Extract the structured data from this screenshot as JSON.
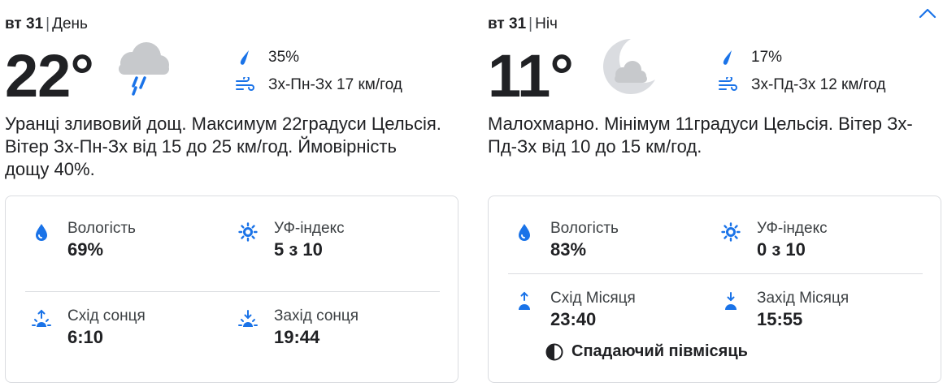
{
  "colors": {
    "accent": "#1a73e8",
    "text": "#202124",
    "muted": "#5f6368",
    "cloud": "#c7c9cc",
    "moon": "#dadce0"
  },
  "day": {
    "date": "вт 31",
    "period": "День",
    "temp": "22°",
    "condition_icon": "rain-shower-cloud-icon",
    "precip": "35%",
    "wind": "Зх-Пн-Зх 17 км/год",
    "description": "Уранці зливовий дощ. Максимум 22градуси Цельсія. Вітер Зх-Пн-Зх від 15 до 25 км/год. Ймовірність дощу 40%.",
    "stats": [
      {
        "label": "Вологість",
        "value": "69%",
        "icon": "humidity-icon"
      },
      {
        "label": "УФ-індекс",
        "value": "5 з 10",
        "icon": "uv-index-icon"
      },
      {
        "label": "Схід сонця",
        "value": "6:10",
        "icon": "sunrise-icon"
      },
      {
        "label": "Захід сонця",
        "value": "19:44",
        "icon": "sunset-icon"
      }
    ]
  },
  "night": {
    "date": "вт 31",
    "period": "Ніч",
    "temp": "11°",
    "condition_icon": "partly-cloudy-night-icon",
    "precip": "17%",
    "wind": "Зх-Пд-Зх 12 км/год",
    "description": "Малохмарно. Мінімум 11градуси Цельсія. Вітер Зх-Пд-Зх від 10 до 15 км/год.",
    "stats": [
      {
        "label": "Вологість",
        "value": "83%",
        "icon": "humidity-icon"
      },
      {
        "label": "УФ-індекс",
        "value": "0 з 10",
        "icon": "uv-index-icon"
      },
      {
        "label": "Схід Місяця",
        "value": "23:40",
        "icon": "moonrise-icon"
      },
      {
        "label": "Захід Місяця",
        "value": "15:55",
        "icon": "moonset-icon"
      }
    ],
    "moon_phase": "Спадаючий півмісяць"
  },
  "collapse_icon": "chevron-up-icon"
}
